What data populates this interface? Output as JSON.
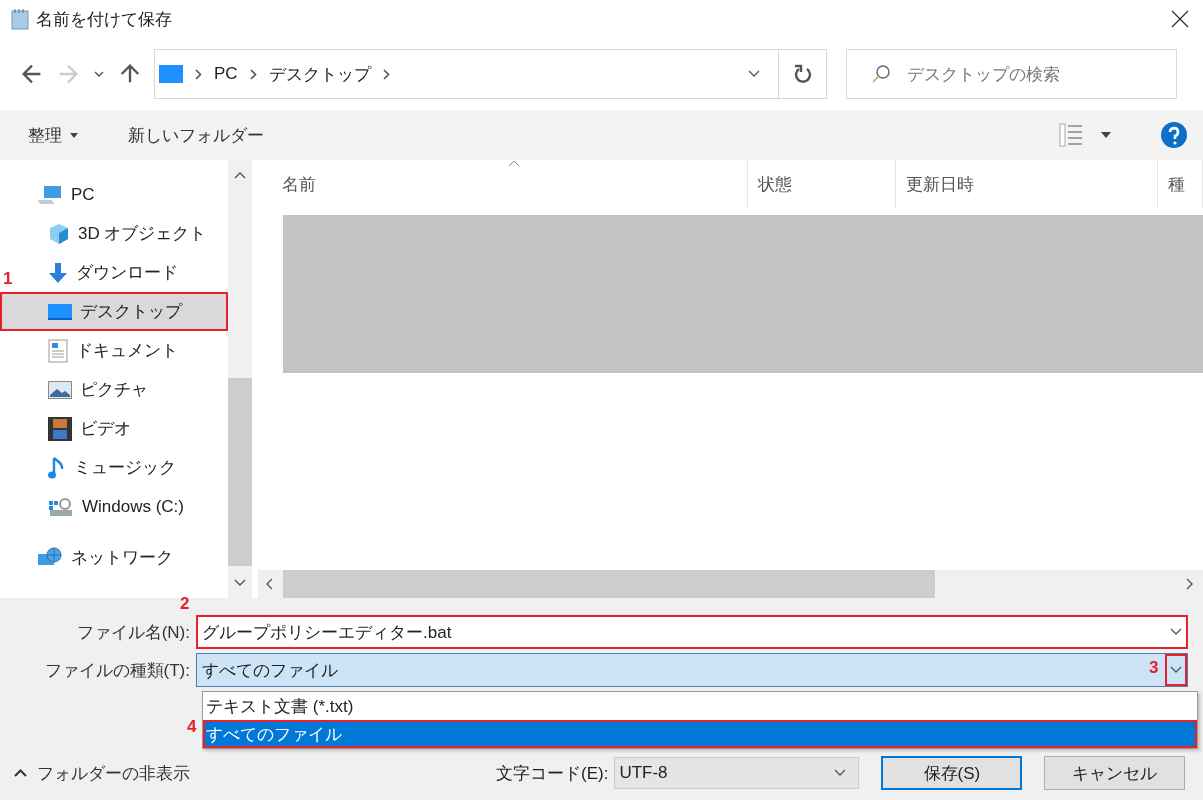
{
  "window": {
    "title": "名前を付けて保存"
  },
  "address": {
    "path": [
      "PC",
      "デスクトップ"
    ]
  },
  "search": {
    "placeholder": "デスクトップの検索"
  },
  "toolbar": {
    "organize": "整理",
    "new_folder": "新しいフォルダー"
  },
  "sidebar": {
    "items": [
      {
        "label": "PC",
        "kind": "pc",
        "selected": false,
        "children": [
          {
            "label": "3D オブジェクト",
            "kind": "cube",
            "selected": false
          },
          {
            "label": "ダウンロード",
            "kind": "download",
            "selected": false
          },
          {
            "label": "デスクトップ",
            "kind": "desktop",
            "selected": true,
            "callout": "1"
          },
          {
            "label": "ドキュメント",
            "kind": "document",
            "selected": false
          },
          {
            "label": "ピクチャ",
            "kind": "picture",
            "selected": false
          },
          {
            "label": "ビデオ",
            "kind": "video",
            "selected": false
          },
          {
            "label": "ミュージック",
            "kind": "music",
            "selected": false
          },
          {
            "label": "Windows (C:)",
            "kind": "drive",
            "selected": false
          }
        ]
      },
      {
        "label": "ネットワーク",
        "kind": "network",
        "selected": false
      }
    ]
  },
  "columns": [
    {
      "label": "名前",
      "sorted": true
    },
    {
      "label": "状態"
    },
    {
      "label": "更新日時"
    },
    {
      "label": "種"
    }
  ],
  "filename": {
    "label": "ファイル名(N):",
    "value": "グループポリシーエディター.bat",
    "callout": "2"
  },
  "filetype": {
    "label": "ファイルの種類(T):",
    "value": "すべてのファイル",
    "expanded": true,
    "callout": "3",
    "options": [
      {
        "label": "テキスト文書 (*.txt)",
        "selected": false
      },
      {
        "label": "すべてのファイル",
        "selected": true,
        "callout": "4"
      }
    ]
  },
  "hide_folders": "フォルダーの非表示",
  "encoding": {
    "label": "文字コード(E):",
    "value": "UTF-8"
  },
  "buttons": [
    {
      "label": "保存(S)",
      "default": true
    },
    {
      "label": "キャンセル",
      "default": false
    }
  ]
}
